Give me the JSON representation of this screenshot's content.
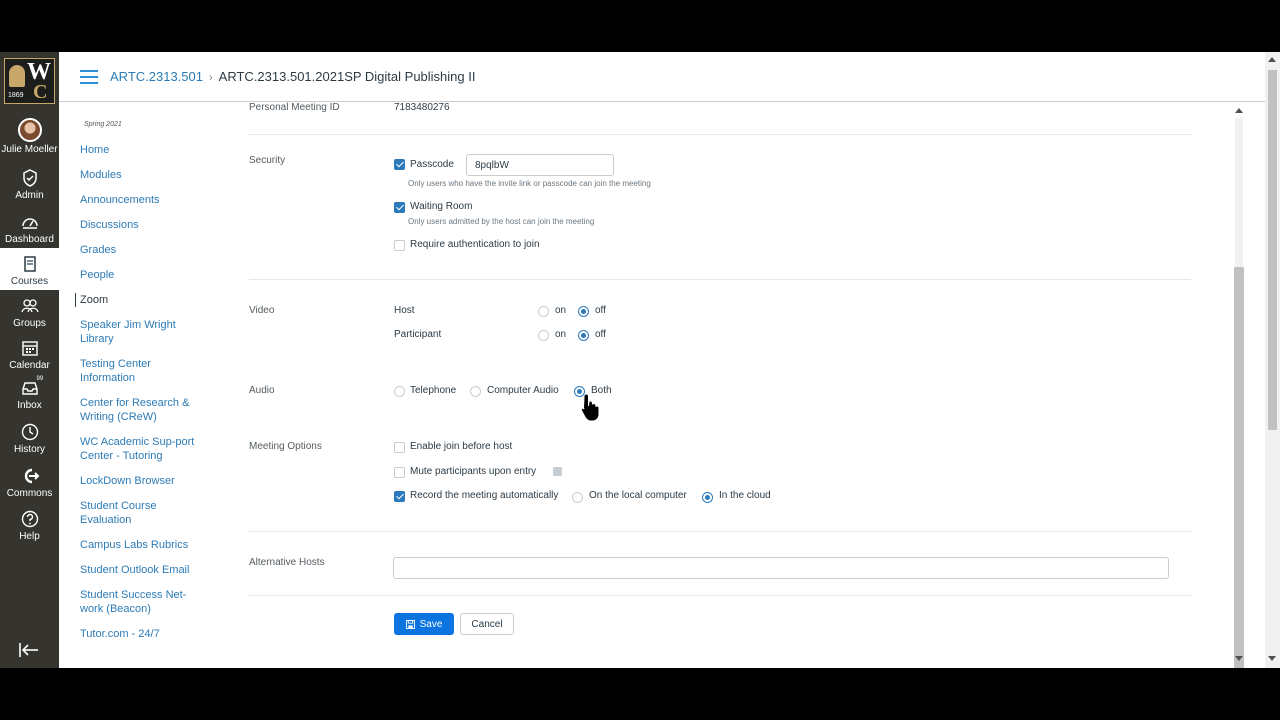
{
  "global_nav": {
    "user_name": "Julie Moeller",
    "items": [
      {
        "label": "Admin",
        "icon": "shield-icon"
      },
      {
        "label": "Dashboard",
        "icon": "dashboard-icon"
      },
      {
        "label": "Courses",
        "icon": "book-icon"
      },
      {
        "label": "Groups",
        "icon": "groups-icon"
      },
      {
        "label": "Calendar",
        "icon": "calendar-icon"
      },
      {
        "label": "Inbox",
        "icon": "inbox-icon",
        "badge": "99"
      },
      {
        "label": "History",
        "icon": "clock-icon"
      },
      {
        "label": "Commons",
        "icon": "commons-icon"
      },
      {
        "label": "Help",
        "icon": "help-icon"
      }
    ],
    "logo": {
      "year": "1869"
    }
  },
  "header": {
    "course_code": "ARTC.2313.501",
    "page_title": "ARTC.2313.501.2021SP Digital Publishing II"
  },
  "course_nav": {
    "term": "Spring 2021",
    "items": [
      "Home",
      "Modules",
      "Announcements",
      "Discussions",
      "Grades",
      "People",
      "Zoom",
      "Speaker Jim Wright Library",
      "Testing Center Information",
      "Center for Research & Writing (CReW)",
      "WC Academic Sup-port Center - Tutoring",
      "LockDown Browser",
      "Student Course Evaluation",
      "Campus Labs Rubrics",
      "Student Outlook Email",
      "Student Success Net-work (Beacon)",
      "Tutor.com - 24/7"
    ],
    "active": "Zoom"
  },
  "form": {
    "pmi_label": "Personal Meeting ID",
    "pmi_value": "7183480276",
    "security_label": "Security",
    "passcode_label": "Passcode",
    "passcode_value": "8pqlbW",
    "passcode_checked": true,
    "passcode_hint": "Only users who have the invite link or passcode can join the meeting",
    "waiting_room_label": "Waiting Room",
    "waiting_room_checked": true,
    "waiting_room_hint": "Only users admitted by the host can join the meeting",
    "require_auth_label": "Require authentication to join",
    "require_auth_checked": false,
    "video_label": "Video",
    "host_label": "Host",
    "participant_label": "Participant",
    "on_label": "on",
    "off_label": "off",
    "host_video": "off",
    "participant_video": "off",
    "audio_label": "Audio",
    "audio_options": [
      "Telephone",
      "Computer Audio",
      "Both"
    ],
    "audio_selected": "Both",
    "meeting_options_label": "Meeting Options",
    "enable_join_label": "Enable join before host",
    "mute_label": "Mute participants upon entry",
    "record_label": "Record the meeting automatically",
    "record_checked": true,
    "record_local_label": "On the local computer",
    "record_cloud_label": "In the cloud",
    "record_location": "In the cloud",
    "alt_hosts_label": "Alternative Hosts",
    "alt_hosts_value": "",
    "save_label": "Save",
    "cancel_label": "Cancel"
  },
  "colors": {
    "accent": "#2b7abc",
    "primary_button": "#0b74de",
    "link": "#2d7bb6",
    "global_nav_bg": "#35342f"
  }
}
